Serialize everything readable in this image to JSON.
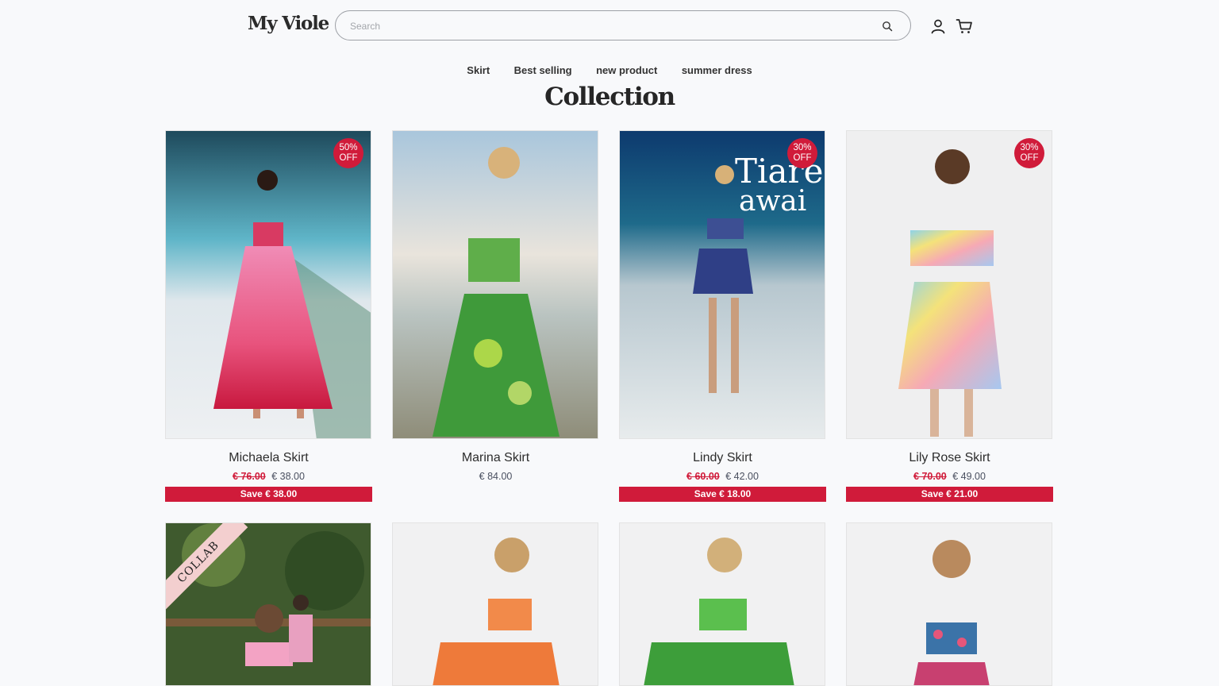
{
  "header": {
    "logo": "My Viole",
    "search_placeholder": "Search",
    "icons": [
      "search-icon",
      "account-icon",
      "cart-icon"
    ]
  },
  "nav": {
    "items": [
      "Skirt",
      "Best selling",
      "new product",
      "summer dress"
    ]
  },
  "page_title": "Collection",
  "colors": {
    "accent": "#d01b3a",
    "background": "#f8f9fb",
    "collab_ribbon": "#f3cfcf"
  },
  "products": [
    {
      "name": "Michaela Skirt",
      "badge": "50%\nOFF",
      "old_price": "€ 76.00",
      "price": "€ 38.00",
      "save": "Save € 38.00"
    },
    {
      "name": "Marina Skirt",
      "badge": null,
      "old_price": null,
      "price": "€ 84.00",
      "save": null
    },
    {
      "name": "Lindy Skirt",
      "badge": "30%\nOFF",
      "old_price": "€ 60.00",
      "price": "€ 42.00",
      "save": "Save € 18.00"
    },
    {
      "name": "Lily Rose Skirt",
      "badge": "30%\nOFF",
      "old_price": "€ 70.00",
      "price": "€ 49.00",
      "save": "Save € 21.00"
    }
  ],
  "row2": [
    {
      "ribbon": "COLLAB"
    },
    {
      "ribbon": null
    },
    {
      "ribbon": null
    },
    {
      "ribbon": null
    }
  ]
}
